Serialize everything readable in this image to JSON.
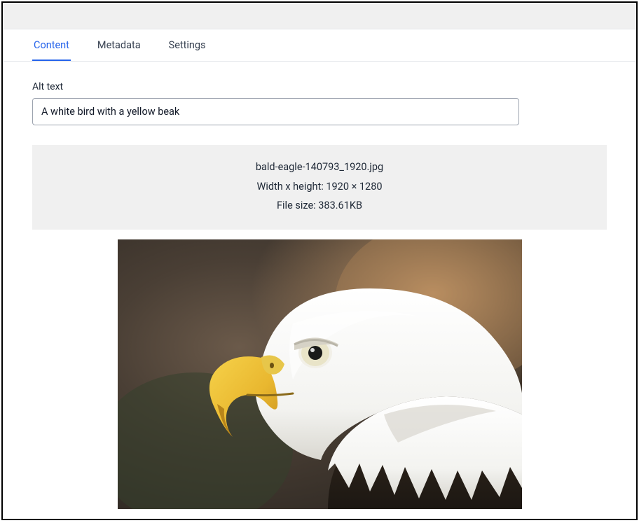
{
  "tabs": [
    {
      "label": "Content",
      "active": true
    },
    {
      "label": "Metadata",
      "active": false
    },
    {
      "label": "Settings",
      "active": false
    }
  ],
  "alt_field": {
    "label": "Alt text",
    "value": "A white bird with a yellow beak"
  },
  "file_info": {
    "filename": "bald-eagle-140793_1920.jpg",
    "dimensions_label": "Width x height:",
    "dimensions_value": "1920 × 1280",
    "filesize_label": "File size:",
    "filesize_value": "383.61KB"
  }
}
